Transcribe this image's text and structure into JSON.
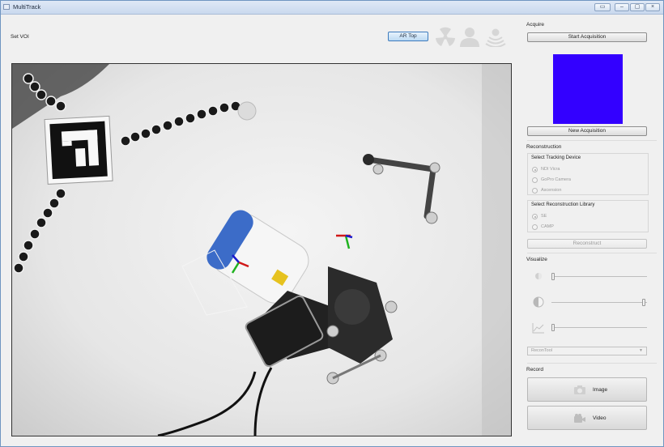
{
  "window": {
    "title": "MultiTrack",
    "controls": [
      "minimize-alt",
      "minimize",
      "restore",
      "close"
    ]
  },
  "toolbar": {
    "set_voi_label": "Set VOI",
    "ar_top_label": "AR Top",
    "status_icons": [
      "radiation-icon",
      "person-icon",
      "signal-person-icon"
    ]
  },
  "camera_view": {
    "description_icon": "camera-feed"
  },
  "acquire": {
    "section_label": "Acquire",
    "start_button": "Start Acquisition",
    "preview_color": "#3300ff",
    "new_button": "New Acquisition"
  },
  "reconstruction": {
    "section_label": "Reconstruction",
    "tracking_group_title": "Select Tracking Device",
    "tracking_options": [
      {
        "label": "NDI Vicra",
        "selected": true
      },
      {
        "label": "GoPro Camera",
        "selected": false
      },
      {
        "label": "Ascension",
        "selected": false
      }
    ],
    "library_group_title": "Select Reconstruction Library",
    "library_options": [
      {
        "label": "SE",
        "selected": true
      },
      {
        "label": "CAMP",
        "selected": false
      }
    ],
    "reconstruct_button": "Reconstruct"
  },
  "visualize": {
    "section_label": "Visualize",
    "sliders": [
      {
        "icon": "brightness-icon",
        "level": 0.0
      },
      {
        "icon": "contrast-icon",
        "level": 1.0
      },
      {
        "icon": "chart-icon",
        "level": 0.0
      }
    ],
    "combo_value": "ReconTool"
  },
  "record": {
    "section_label": "Record",
    "image_button": "Image",
    "video_button": "Video"
  }
}
